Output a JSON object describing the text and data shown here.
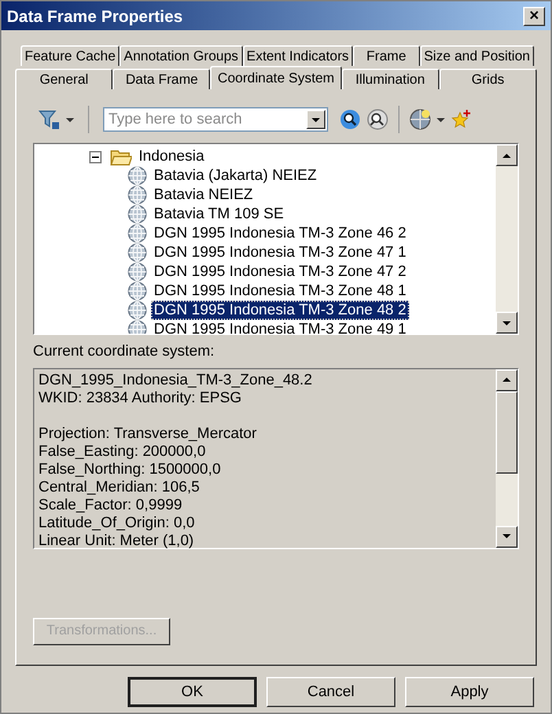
{
  "window": {
    "title": "Data Frame Properties",
    "close": "×"
  },
  "tab_rows": [
    [
      {
        "label": "Feature Cache",
        "selected": false
      },
      {
        "label": "Annotation Groups",
        "selected": false
      },
      {
        "label": "Extent Indicators",
        "selected": false
      },
      {
        "label": "Frame",
        "selected": false
      },
      {
        "label": "Size and Position",
        "selected": false
      }
    ],
    [
      {
        "label": "General",
        "selected": false
      },
      {
        "label": "Data Frame",
        "selected": false
      },
      {
        "label": "Coordinate System",
        "selected": true
      },
      {
        "label": "Illumination",
        "selected": false
      },
      {
        "label": "Grids",
        "selected": false
      }
    ]
  ],
  "search": {
    "placeholder": "Type here to search"
  },
  "tree": [
    {
      "kind": "folder",
      "label": "Indonesia",
      "expanded": true,
      "children": [
        {
          "kind": "crs",
          "label": "Batavia (Jakarta) NEIEZ",
          "selected": false
        },
        {
          "kind": "crs",
          "label": "Batavia NEIEZ",
          "selected": false
        },
        {
          "kind": "crs",
          "label": "Batavia TM 109 SE",
          "selected": false
        },
        {
          "kind": "crs",
          "label": "DGN 1995 Indonesia TM-3 Zone 46 2",
          "selected": false
        },
        {
          "kind": "crs",
          "label": "DGN 1995 Indonesia TM-3 Zone 47 1",
          "selected": false
        },
        {
          "kind": "crs",
          "label": "DGN 1995 Indonesia TM-3 Zone 47 2",
          "selected": false
        },
        {
          "kind": "crs",
          "label": "DGN 1995 Indonesia TM-3 Zone 48 1",
          "selected": false
        },
        {
          "kind": "crs",
          "label": "DGN 1995 Indonesia TM-3 Zone 48 2",
          "selected": true
        },
        {
          "kind": "crs",
          "label": "DGN 1995 Indonesia TM-3 Zone 49 1",
          "selected": false
        }
      ]
    }
  ],
  "current_label": "Current coordinate system:",
  "details": [
    [
      "DGN_1995_Indonesia_TM-3_Zone_48.2",
      "WKID: 23834 Authority: EPSG"
    ],
    [
      "Projection: Transverse_Mercator",
      "False_Easting: 200000,0",
      "False_Northing: 1500000,0",
      "Central_Meridian: 106,5",
      "Scale_Factor: 0,9999",
      "Latitude_Of_Origin: 0,0",
      "Linear Unit: Meter (1,0)"
    ]
  ],
  "transformations": {
    "label": "Transformations...",
    "disabled": true
  },
  "buttons": [
    {
      "label": "OK",
      "default": true
    },
    {
      "label": "Cancel",
      "default": false
    },
    {
      "label": "Apply",
      "default": false
    }
  ]
}
